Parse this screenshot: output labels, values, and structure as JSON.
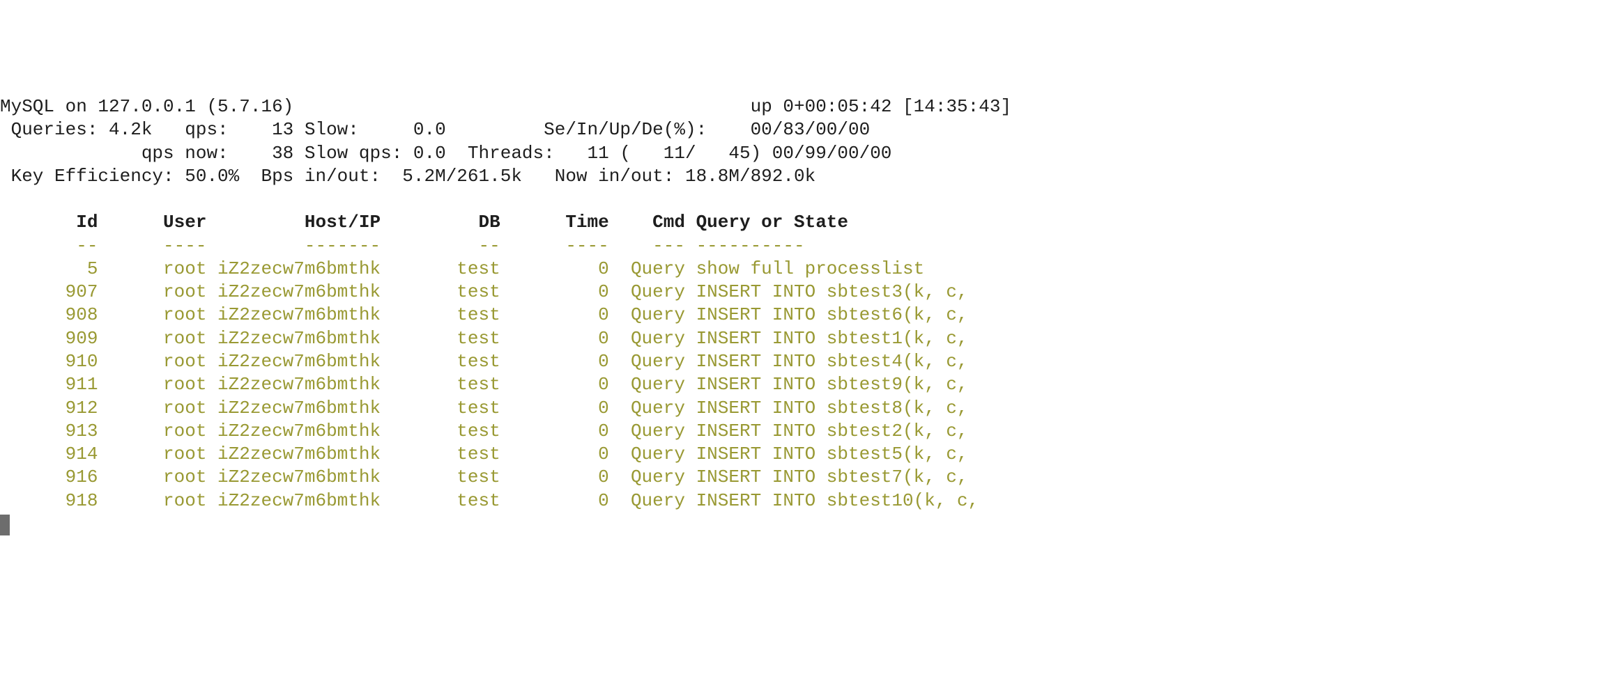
{
  "header": {
    "title_left": "MySQL on 127.0.0.1 (5.7.16)",
    "title_right": "up 0+00:05:42 [14:35:43]",
    "line2": " Queries: 4.2k   qps:    13 Slow:     0.0         Se/In/Up/De(%):    00/83/00/00",
    "line3": "             qps now:    38 Slow qps: 0.0  Threads:   11 (   11/   45) 00/99/00/00",
    "line4": " Key Efficiency: 50.0%  Bps in/out:  5.2M/261.5k   Now in/out: 18.8M/892.0k"
  },
  "process_table": {
    "headers_line": "       Id      User         Host/IP         DB      Time    Cmd Query or State",
    "dashes_line": "       --      ----         -------         --      ----    --- ----------",
    "rows": [
      {
        "line": "        5      root iZ2zecw7m6bmthk       test         0  Query show full processlist"
      },
      {
        "line": "      907      root iZ2zecw7m6bmthk       test         0  Query INSERT INTO sbtest3(k, c,"
      },
      {
        "line": "      908      root iZ2zecw7m6bmthk       test         0  Query INSERT INTO sbtest6(k, c,"
      },
      {
        "line": "      909      root iZ2zecw7m6bmthk       test         0  Query INSERT INTO sbtest1(k, c,"
      },
      {
        "line": "      910      root iZ2zecw7m6bmthk       test         0  Query INSERT INTO sbtest4(k, c,"
      },
      {
        "line": "      911      root iZ2zecw7m6bmthk       test         0  Query INSERT INTO sbtest9(k, c,"
      },
      {
        "line": "      912      root iZ2zecw7m6bmthk       test         0  Query INSERT INTO sbtest8(k, c,"
      },
      {
        "line": "      913      root iZ2zecw7m6bmthk       test         0  Query INSERT INTO sbtest2(k, c,"
      },
      {
        "line": "      914      root iZ2zecw7m6bmthk       test         0  Query INSERT INTO sbtest5(k, c,"
      },
      {
        "line": "      916      root iZ2zecw7m6bmthk       test         0  Query INSERT INTO sbtest7(k, c,"
      },
      {
        "line": "      918      root iZ2zecw7m6bmthk       test         0  Query INSERT INTO sbtest10(k, c,"
      }
    ]
  }
}
